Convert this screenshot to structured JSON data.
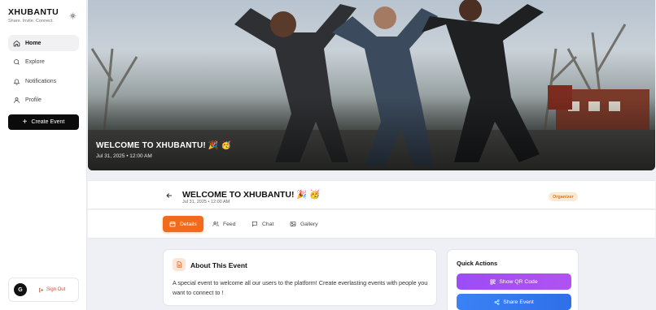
{
  "brand": {
    "title": "XHUBANTU",
    "tagline": "Share. Invite. Connect."
  },
  "sidebar": {
    "items": [
      {
        "label": "Home",
        "icon": "home-icon",
        "active": true
      },
      {
        "label": "Explore",
        "icon": "search-icon",
        "active": false
      },
      {
        "label": "Notifications",
        "icon": "bell-icon",
        "active": false
      },
      {
        "label": "Profile",
        "icon": "user-icon",
        "active": false
      }
    ],
    "create_label": "Create Event",
    "user_initial": "G",
    "signout_label": "Sign Out"
  },
  "hero": {
    "title": "WELCOME TO XHUBANTU! 🎉 🥳",
    "date": "Jul 31, 2025 • 12:00 AM"
  },
  "event": {
    "title": "WELCOME TO XHUBANTU! 🎉 🥳",
    "date": "Jul 31, 2025 • 12:00 AM",
    "badge": "Organizer"
  },
  "tabs": [
    {
      "label": "Details",
      "icon": "calendar-icon",
      "active": true
    },
    {
      "label": "Feed",
      "icon": "users-icon",
      "active": false
    },
    {
      "label": "Chat",
      "icon": "chat-icon",
      "active": false
    },
    {
      "label": "Gallery",
      "icon": "image-icon",
      "active": false
    }
  ],
  "about": {
    "title": "About This Event",
    "text": "A special event to welcome all our users to the platform! Create everlasting events with people you want to connect to !"
  },
  "quick_actions": {
    "title": "Quick Actions",
    "qr_label": "Show QR Code",
    "share_label": "Share Event"
  },
  "colors": {
    "accent": "#f26b1d",
    "qr": "#a34ff4",
    "share": "#3b82f6",
    "signout": "#e0463a"
  }
}
